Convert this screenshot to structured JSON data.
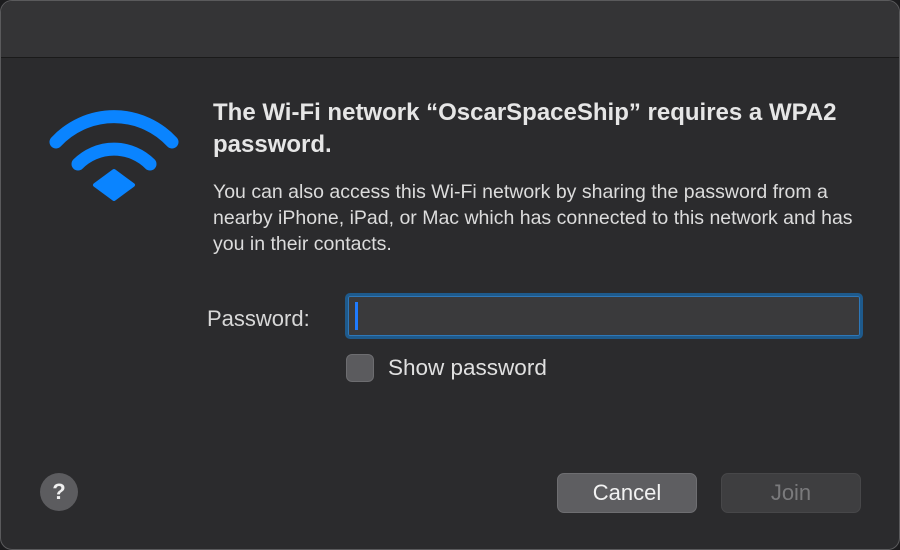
{
  "dialog": {
    "heading": "The Wi-Fi network “OscarSpaceShip” requires a WPA2 password.",
    "description": "You can also access this Wi-Fi network by sharing the password from a nearby iPhone, iPad, or Mac which has connected to this network and has you in their contacts.",
    "icon": "wifi-icon",
    "accent_color": "#0a84ff"
  },
  "password": {
    "label": "Password:",
    "value": "",
    "placeholder": ""
  },
  "show_password": {
    "label": "Show password",
    "checked": false
  },
  "buttons": {
    "help": "?",
    "cancel": "Cancel",
    "join": "Join"
  }
}
